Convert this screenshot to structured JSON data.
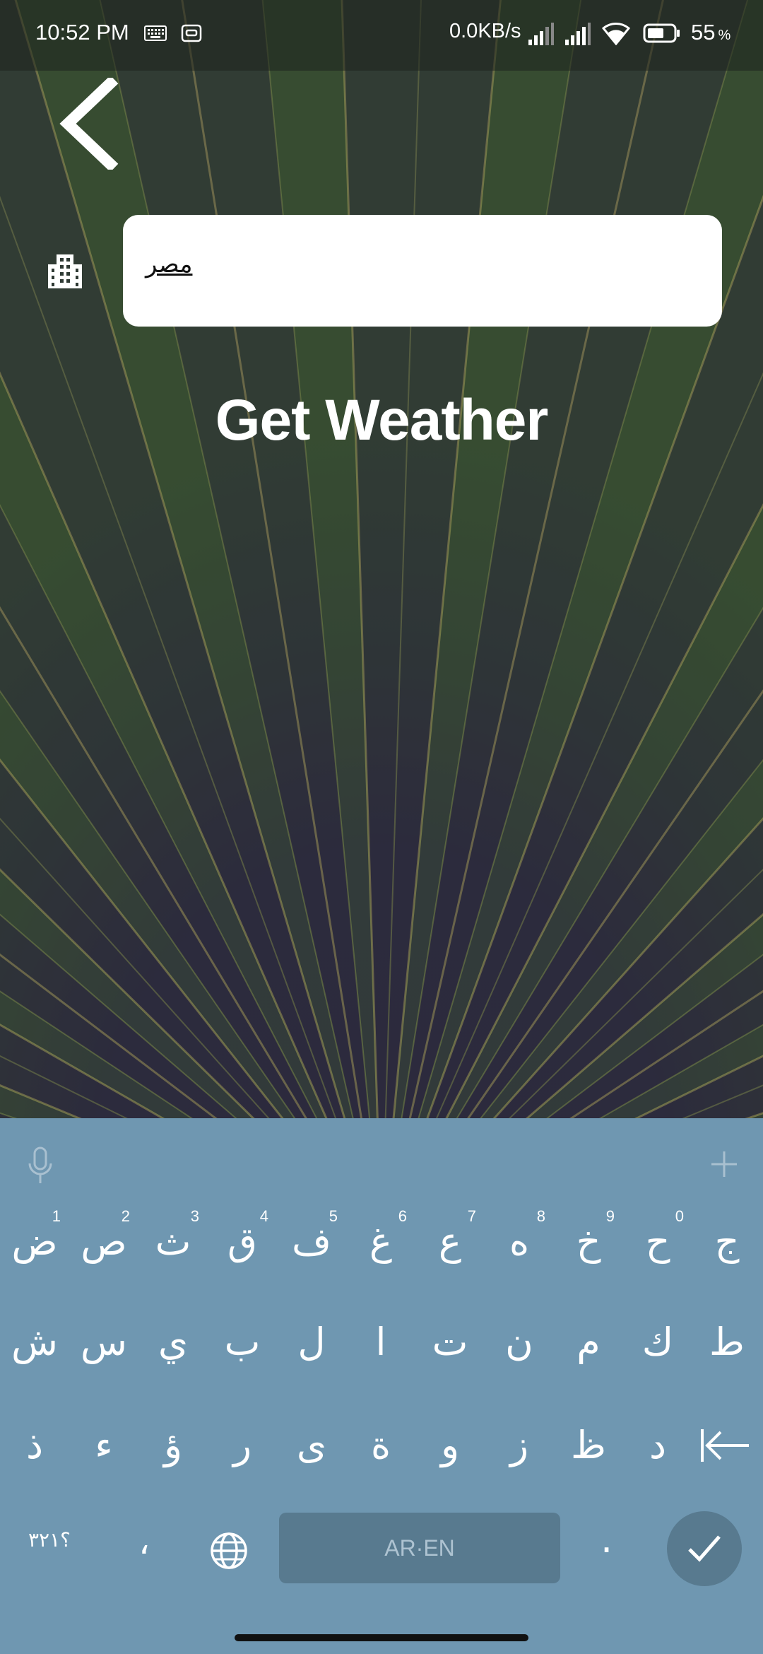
{
  "status_bar": {
    "time": "10:52 PM",
    "network_speed": "0.0KB/s",
    "battery_level": "55",
    "battery_unit": "%",
    "icons": [
      "keyboard-icon",
      "cast-icon",
      "signal-icon",
      "signal-icon",
      "wifi-icon",
      "battery-icon"
    ]
  },
  "header": {
    "back_icon": "chevron-left-icon"
  },
  "form": {
    "city_icon": "city-buildings-icon",
    "city_value": "مصر",
    "submit_label": "Get Weather"
  },
  "keyboard": {
    "toolbar_icons": [
      "microphone-icon",
      "plus-icon"
    ],
    "row1": [
      {
        "char": "ض",
        "hint": "1"
      },
      {
        "char": "ص",
        "hint": "2"
      },
      {
        "char": "ث",
        "hint": "3"
      },
      {
        "char": "ق",
        "hint": "4"
      },
      {
        "char": "ف",
        "hint": "5"
      },
      {
        "char": "غ",
        "hint": "6"
      },
      {
        "char": "ع",
        "hint": "7"
      },
      {
        "char": "ه",
        "hint": "8"
      },
      {
        "char": "خ",
        "hint": "9"
      },
      {
        "char": "ح",
        "hint": "0"
      },
      {
        "char": "ج",
        "hint": ""
      }
    ],
    "row2": [
      "ش",
      "س",
      "ي",
      "ب",
      "ل",
      "ا",
      "ت",
      "ن",
      "م",
      "ك",
      "ط"
    ],
    "row3": [
      "ذ",
      "ء",
      "ؤ",
      "ر",
      "ى",
      "ة",
      "و",
      "ز",
      "ظ",
      "د"
    ],
    "bottom": {
      "numbers_label": "؟٣٢١",
      "comma_label": "،",
      "space_label": "AR·EN",
      "period_label": ".",
      "globe_icon": "globe-icon",
      "done_icon": "checkmark-icon",
      "backspace_icon": "backspace-arrow-icon"
    }
  },
  "colors": {
    "keyboard_bg": "#6f97b1",
    "key_dark": "#587a8f",
    "text": "#ffffff"
  }
}
